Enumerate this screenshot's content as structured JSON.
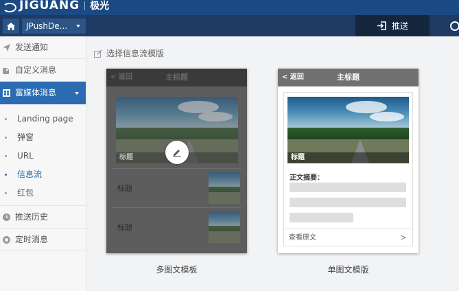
{
  "brand": {
    "name": "JIGUANG",
    "name_cn": "极光"
  },
  "nav": {
    "app_selector": "JPushDe...",
    "push_tab": "推送"
  },
  "sidebar": {
    "items": [
      {
        "label": "发送通知"
      },
      {
        "label": "自定义消息"
      },
      {
        "label": "富媒体消息"
      }
    ],
    "sub_items": [
      {
        "label": "Landing page"
      },
      {
        "label": "弹窗"
      },
      {
        "label": "URL"
      },
      {
        "label": "信息流"
      },
      {
        "label": "红包"
      }
    ],
    "bottom_items": [
      {
        "label": "推送历史"
      },
      {
        "label": "定时消息"
      }
    ]
  },
  "main": {
    "section_title": "选择信息流模版",
    "multi_card": {
      "back": "< 返回",
      "header_title": "主标题",
      "hero_caption": "标题",
      "rows": [
        "标题",
        "标题"
      ],
      "label": "多图文模板"
    },
    "single_card": {
      "back": "< 返回",
      "header_title": "主标题",
      "hero_caption": "标题",
      "summary_label": "正文摘要：",
      "footer_link": "查看原文",
      "footer_chevron": ">",
      "label": "单图文模版"
    }
  },
  "colors": {
    "brand_bar": "#1b4a82",
    "nav_bar": "#1d3b63",
    "sidebar_active": "#2a6bb2",
    "current_sub": "#2a6bb2"
  }
}
